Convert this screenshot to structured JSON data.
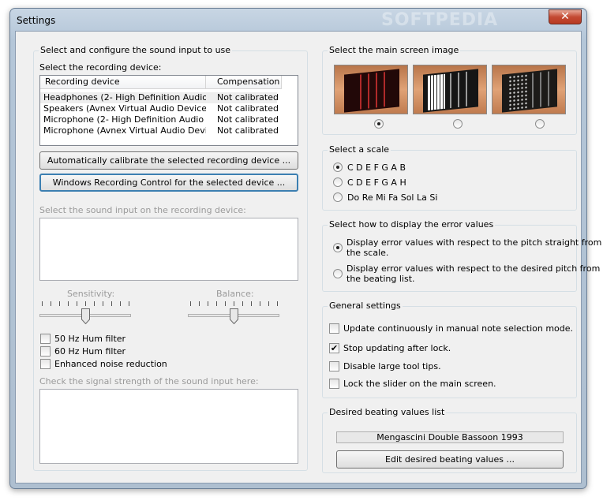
{
  "window": {
    "title": "Settings",
    "watermark": "SOFTPEDIA",
    "close_label": "✕"
  },
  "input_group": {
    "title": "Select and configure the sound input to use",
    "device_label": "Select the recording device:",
    "columns": [
      "Recording device",
      "Compensation"
    ],
    "devices": [
      {
        "name": "Headphones (2- High Definition Audio De...",
        "compensation": "Not calibrated"
      },
      {
        "name": "Speakers (Avnex Virtual Audio Device)",
        "compensation": "Not calibrated"
      },
      {
        "name": "Microphone (2- High Definition Audio De...",
        "compensation": "Not calibrated"
      },
      {
        "name": "Microphone (Avnex Virtual Audio Device)",
        "compensation": "Not calibrated"
      }
    ],
    "calibrate_button": "Automatically calibrate the selected recording device ...",
    "recording_control_button": "Windows Recording Control for the selected device ...",
    "sound_input_label": "Select the sound input on the recording device:",
    "sensitivity_label": "Sensitivity:",
    "balance_label": "Balance:",
    "sensitivity_value": 0.5,
    "balance_value": 0.5,
    "filters": [
      {
        "label": "50 Hz Hum filter",
        "checked": false
      },
      {
        "label": "60 Hz Hum filter",
        "checked": false
      },
      {
        "label": "Enhanced noise reduction",
        "checked": false
      }
    ],
    "signal_label": "Check the signal strength of the sound input here:"
  },
  "screen_image": {
    "title": "Select the main screen image",
    "selected_index": 0
  },
  "scale": {
    "title": "Select a scale",
    "options": [
      "C D E F G A B",
      "C D E F G A H",
      "Do Re Mi Fa Sol La Si"
    ],
    "selected_index": 0
  },
  "error_display": {
    "title": "Select how to display the error values",
    "options": [
      [
        "Display error values with respect to the pitch straight from",
        "the scale."
      ],
      [
        "Display error values with respect to the desired pitch from",
        "the beating list."
      ]
    ],
    "selected_index": 0
  },
  "general": {
    "title": "General settings",
    "items": [
      {
        "label": "Update continuously in manual note selection mode.",
        "checked": false
      },
      {
        "label": "Stop updating after lock.",
        "checked": true
      },
      {
        "label": "Disable large tool tips.",
        "checked": false
      },
      {
        "label": "Lock the slider on the main screen.",
        "checked": false
      }
    ]
  },
  "beating": {
    "title": "Desired beating values list",
    "current": "Mengascini Double Bassoon 1993",
    "edit_button": "Edit desired beating values ..."
  },
  "colors": {
    "title_bar": "#b4c6d8",
    "close_button": "#c44a33",
    "dialog_bg": "#f0f0f0",
    "accent": "#3c7fb1"
  }
}
